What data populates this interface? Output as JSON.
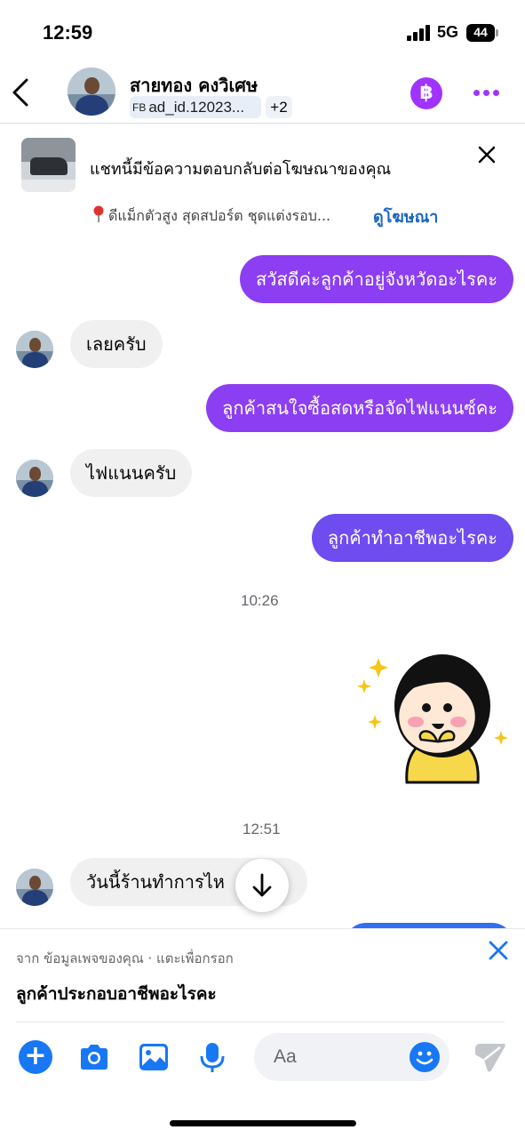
{
  "status_bar": {
    "time": "12:59",
    "network": "5G",
    "battery": "44"
  },
  "header": {
    "name": "สายทอง คงวิเศษ",
    "fb_badge": "FB",
    "ad_id": "ad_id.12023...",
    "extra_count": "+2",
    "coin_label": "฿"
  },
  "ad_banner": {
    "title": "แชทนี้มีข้อความตอบกลับต่อโฆษณาของคุณ",
    "description": "ดีแม็กตัวสูง สุดสปอร์ต ชุดแต่งรอบ...",
    "view_ad_label": "ดูโฆษณา"
  },
  "messages": [
    {
      "direction": "out",
      "text": "สวัสดีค่ะลูกค้าอยู่จังหวัดอะไรคะ"
    },
    {
      "direction": "in",
      "text": "เลยครับ"
    },
    {
      "direction": "out",
      "text": "ลูกค้าสนใจซื้อสดหรือจัดไฟแนนซ์คะ"
    },
    {
      "direction": "in",
      "text": "ไฟแนนครับ"
    },
    {
      "direction": "out",
      "text": "ลูกค้าทำอาชีพอะไรคะ"
    },
    {
      "direction": "in",
      "text": "วันนี้ร้านทำการไห"
    }
  ],
  "timestamps": [
    "10:26",
    "12:51"
  ],
  "suggestion": {
    "source": "จาก ข้อมูลเพจของคุณ · แตะเพื่อกรอก",
    "text": "ลูกค้าประกอบอาชีพอะไรคะ"
  },
  "composer": {
    "placeholder": "Aa"
  },
  "colors": {
    "outgoing_bubble": "#8c3ef2",
    "accent_purple": "#a033ff",
    "link_blue": "#1a66c4",
    "messenger_blue": "#1877f2"
  },
  "icons": [
    "back-icon",
    "coin-icon",
    "more-icon",
    "close-icon",
    "pin-icon",
    "arrow-down-icon",
    "plus-icon",
    "camera-icon",
    "image-icon",
    "microphone-icon",
    "emoji-icon",
    "send-icon"
  ]
}
